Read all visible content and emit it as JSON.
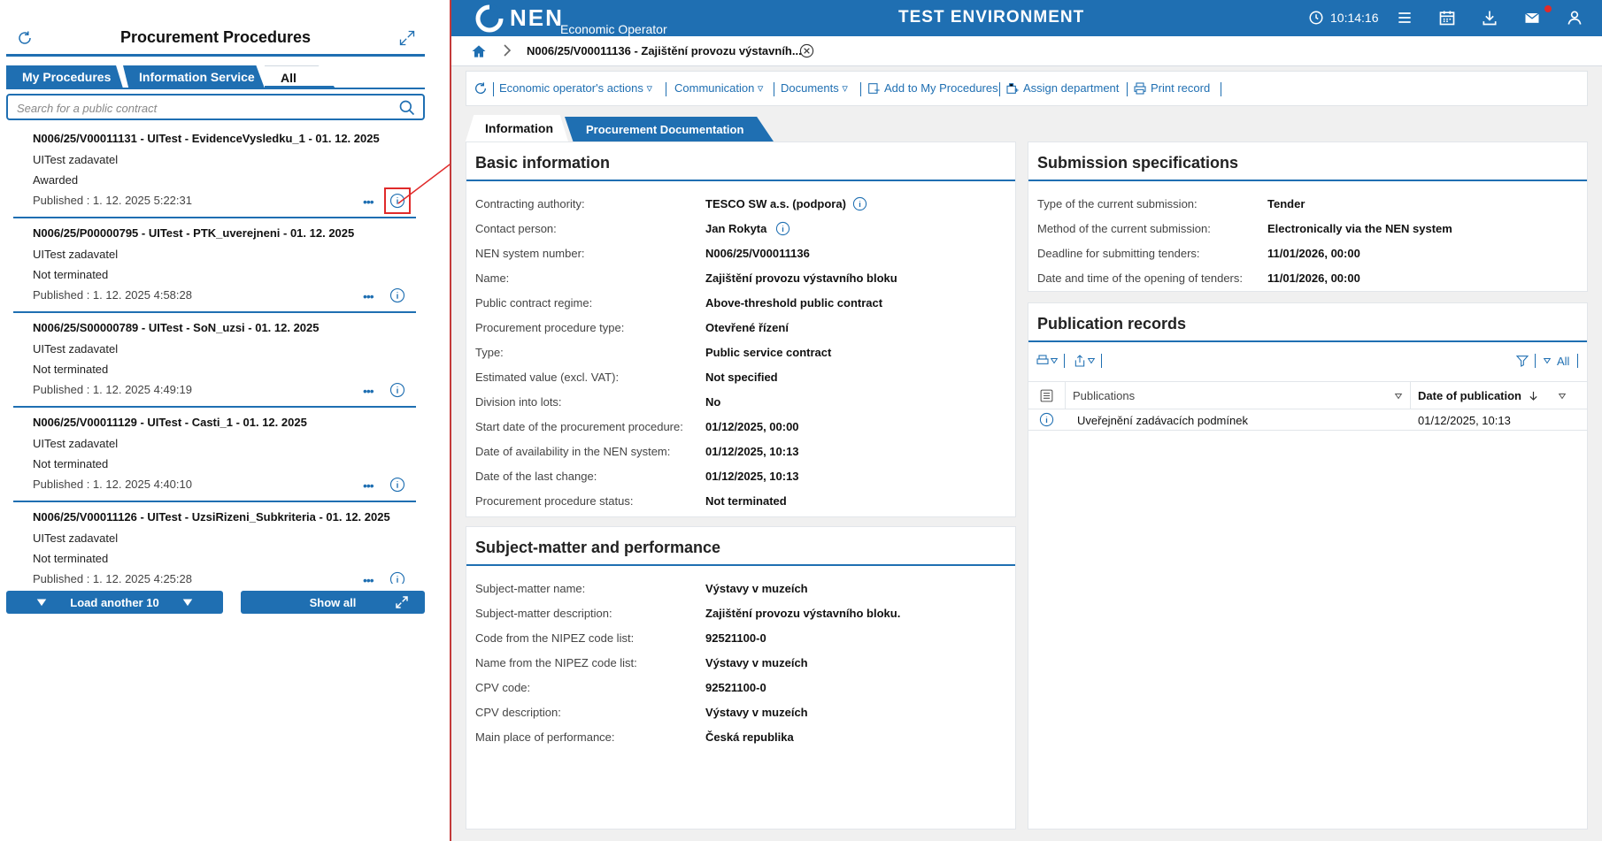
{
  "left_panel": {
    "title": "Procurement Procedures",
    "tabs": [
      "My Procedures",
      "Information Service",
      "All"
    ],
    "search_placeholder": "Search for a public contract",
    "items": [
      {
        "title": "N006/25/V00011131 - UITest - EvidenceVysledku_1 - 01. 12. 2025",
        "authority": "UITest zadavatel",
        "status": "Awarded",
        "published": "Published : 1. 12. 2025 5:22:31"
      },
      {
        "title": "N006/25/P00000795 - UITest - PTK_uverejneni - 01. 12. 2025",
        "authority": "UITest zadavatel",
        "status": "Not terminated",
        "published": "Published : 1. 12. 2025 4:58:28"
      },
      {
        "title": "N006/25/S00000789 - UITest - SoN_uzsi - 01. 12. 2025",
        "authority": "UITest zadavatel",
        "status": "Not terminated",
        "published": "Published : 1. 12. 2025 4:49:19"
      },
      {
        "title": "N006/25/V00011129 - UITest - Casti_1 - 01. 12. 2025",
        "authority": "UITest zadavatel",
        "status": "Not terminated",
        "published": "Published : 1. 12. 2025 4:40:10"
      },
      {
        "title": "N006/25/V00011126 - UITest - UzsiRizeni_Subkriteria - 01. 12. 2025",
        "authority": "UITest zadavatel",
        "status": "Not terminated",
        "published": "Published : 1. 12. 2025 4:25:28"
      }
    ],
    "more_glyph": "•••",
    "load_more_label": "Load another 10",
    "show_all_label": "Show all"
  },
  "header": {
    "brand": "NEN",
    "role": "Economic Operator",
    "environment": "TEST ENVIRONMENT",
    "time": "10:14:16"
  },
  "breadcrumb": {
    "current": "N006/25/V00011136 - Zajištění provozu výstavníh..."
  },
  "toolbar": {
    "actions": [
      "Economic operator's actions ▿",
      "Communication ▿",
      "Documents ▿",
      "Add to My Procedures",
      "Assign department",
      "Print record"
    ]
  },
  "page_tabs": [
    "Information",
    "Procurement Documentation"
  ],
  "basic_info": {
    "heading": "Basic information",
    "rows": [
      {
        "k": "Contracting authority:",
        "v": "TESCO SW a.s. (podpora)"
      },
      {
        "k": "Contact person:",
        "v": "Jan Rokyta"
      },
      {
        "k": "NEN system number:",
        "v": "N006/25/V00011136"
      },
      {
        "k": "Name:",
        "v": "Zajištění provozu výstavního bloku"
      },
      {
        "k": "Public contract regime:",
        "v": "Above-threshold public contract"
      },
      {
        "k": "Procurement procedure type:",
        "v": "Otevřené řízení"
      },
      {
        "k": "Type:",
        "v": "Public service contract"
      },
      {
        "k": "Estimated value (excl. VAT):",
        "v": "Not specified"
      },
      {
        "k": "Division into lots:",
        "v": "No"
      },
      {
        "k": "Start date of the procurement procedure:",
        "v": "01/12/2025, 00:00"
      },
      {
        "k": "Date of availability in the NEN system:",
        "v": "01/12/2025, 10:13"
      },
      {
        "k": "Date of the last change:",
        "v": "01/12/2025, 10:13"
      },
      {
        "k": "Procurement procedure status:",
        "v": "Not terminated"
      }
    ]
  },
  "subject": {
    "heading": "Subject-matter and performance",
    "rows": [
      {
        "k": "Subject-matter name:",
        "v": "Výstavy v muzeích"
      },
      {
        "k": "Subject-matter description:",
        "v": "Zajištění provozu výstavního bloku."
      },
      {
        "k": "Code from the NIPEZ code list:",
        "v": "92521100-0"
      },
      {
        "k": "Name from the NIPEZ code list:",
        "v": "Výstavy v muzeích"
      },
      {
        "k": "CPV code:",
        "v": "92521100-0"
      },
      {
        "k": "CPV description:",
        "v": "Výstavy v muzeích"
      },
      {
        "k": "Main place of performance:",
        "v": "Česká republika"
      }
    ]
  },
  "submission": {
    "heading": "Submission specifications",
    "rows": [
      {
        "k": "Type of the current submission:",
        "v": "Tender"
      },
      {
        "k": "Method of the current submission:",
        "v": "Electronically via the NEN system"
      },
      {
        "k": "Deadline for submitting tenders:",
        "v": "11/01/2026, 00:00"
      },
      {
        "k": "Date and time of the opening of tenders:",
        "v": "11/01/2026, 00:00"
      }
    ]
  },
  "publication": {
    "heading": "Publication records",
    "filter_label": "All",
    "columns": [
      "Publications",
      "Date of publication"
    ],
    "rows": [
      {
        "name": "Uveřejnění zadávacích podmínek",
        "date": "01/12/2025, 10:13"
      }
    ]
  },
  "colors": {
    "accent": "#1f6fb2",
    "highlight": "#e02a2a"
  }
}
